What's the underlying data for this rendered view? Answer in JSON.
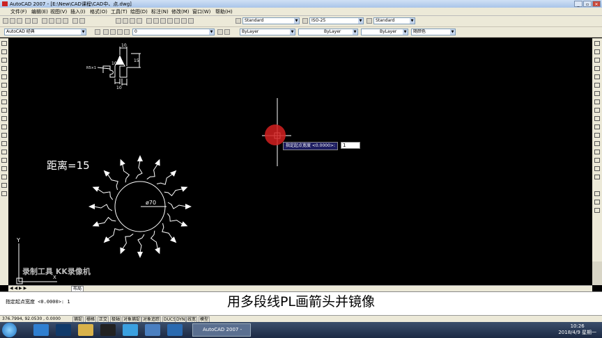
{
  "window": {
    "title": "AutoCAD 2007 - [E:\\New\\CAD课程\\CAD中、点.dwg]"
  },
  "menu": {
    "items": [
      "文件(F)",
      "编辑(E)",
      "视图(V)",
      "插入(I)",
      "格式(O)",
      "工具(T)",
      "绘图(D)",
      "标注(N)",
      "修改(M)",
      "窗口(W)",
      "帮助(H)"
    ]
  },
  "toolbar": {
    "workspace": "AutoCAD 经典",
    "layer": "0",
    "text_style": "Standard",
    "dim_style": "ISO-25",
    "table_style": "Standard",
    "color": "ByLayer",
    "linetype": "ByLayer",
    "lineweight": "ByLayer",
    "plot_style": "随颜色"
  },
  "canvas": {
    "distance_label": "距离=15",
    "dim_diameter": "ø70",
    "dim_small_10a": "10",
    "dim_small_10b": "10",
    "dim_small_10c": "10",
    "dim_small_15": "15",
    "dim_small_r": "R5×1",
    "ucs_y": "Y",
    "ucs_x": "X",
    "tooltip_prompt": "指定起点宽度 <0.0000>:",
    "input_value": "1",
    "watermark": "录制工具 KK录像机"
  },
  "layout_tabs": {
    "active": "布局"
  },
  "command": {
    "history": "指定起点宽度 <0.0000>: 1"
  },
  "subtitle": "用多段线PL画箭头并镜像",
  "status": {
    "coords": "376.7994, 92.0530 , 0.0000",
    "buttons": [
      "捕捉",
      "栅格",
      "正交",
      "极轴",
      "对象捕捉",
      "对象追踪",
      "DUCS",
      "DYN",
      "线宽",
      "模型"
    ]
  },
  "taskbar": {
    "active_app": "AutoCAD 2007 -",
    "time": "10:26",
    "date": "2018/4/9 星期一"
  },
  "colors": {
    "canvas": "#000000",
    "drawing_lines": "#ffffff",
    "ui_chrome": "#ece9d8",
    "cursor_highlight": "#d42020"
  }
}
